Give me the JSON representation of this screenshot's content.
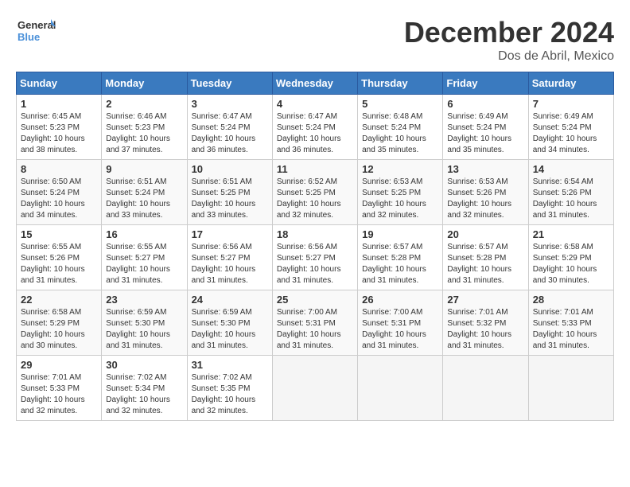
{
  "logo": {
    "text_general": "General",
    "text_blue": "Blue"
  },
  "header": {
    "month": "December 2024",
    "location": "Dos de Abril, Mexico"
  },
  "weekdays": [
    "Sunday",
    "Monday",
    "Tuesday",
    "Wednesday",
    "Thursday",
    "Friday",
    "Saturday"
  ],
  "weeks": [
    [
      {
        "day": "1",
        "info": "Sunrise: 6:45 AM\nSunset: 5:23 PM\nDaylight: 10 hours\nand 38 minutes."
      },
      {
        "day": "2",
        "info": "Sunrise: 6:46 AM\nSunset: 5:23 PM\nDaylight: 10 hours\nand 37 minutes."
      },
      {
        "day": "3",
        "info": "Sunrise: 6:47 AM\nSunset: 5:24 PM\nDaylight: 10 hours\nand 36 minutes."
      },
      {
        "day": "4",
        "info": "Sunrise: 6:47 AM\nSunset: 5:24 PM\nDaylight: 10 hours\nand 36 minutes."
      },
      {
        "day": "5",
        "info": "Sunrise: 6:48 AM\nSunset: 5:24 PM\nDaylight: 10 hours\nand 35 minutes."
      },
      {
        "day": "6",
        "info": "Sunrise: 6:49 AM\nSunset: 5:24 PM\nDaylight: 10 hours\nand 35 minutes."
      },
      {
        "day": "7",
        "info": "Sunrise: 6:49 AM\nSunset: 5:24 PM\nDaylight: 10 hours\nand 34 minutes."
      }
    ],
    [
      {
        "day": "8",
        "info": "Sunrise: 6:50 AM\nSunset: 5:24 PM\nDaylight: 10 hours\nand 34 minutes."
      },
      {
        "day": "9",
        "info": "Sunrise: 6:51 AM\nSunset: 5:24 PM\nDaylight: 10 hours\nand 33 minutes."
      },
      {
        "day": "10",
        "info": "Sunrise: 6:51 AM\nSunset: 5:25 PM\nDaylight: 10 hours\nand 33 minutes."
      },
      {
        "day": "11",
        "info": "Sunrise: 6:52 AM\nSunset: 5:25 PM\nDaylight: 10 hours\nand 32 minutes."
      },
      {
        "day": "12",
        "info": "Sunrise: 6:53 AM\nSunset: 5:25 PM\nDaylight: 10 hours\nand 32 minutes."
      },
      {
        "day": "13",
        "info": "Sunrise: 6:53 AM\nSunset: 5:26 PM\nDaylight: 10 hours\nand 32 minutes."
      },
      {
        "day": "14",
        "info": "Sunrise: 6:54 AM\nSunset: 5:26 PM\nDaylight: 10 hours\nand 31 minutes."
      }
    ],
    [
      {
        "day": "15",
        "info": "Sunrise: 6:55 AM\nSunset: 5:26 PM\nDaylight: 10 hours\nand 31 minutes."
      },
      {
        "day": "16",
        "info": "Sunrise: 6:55 AM\nSunset: 5:27 PM\nDaylight: 10 hours\nand 31 minutes."
      },
      {
        "day": "17",
        "info": "Sunrise: 6:56 AM\nSunset: 5:27 PM\nDaylight: 10 hours\nand 31 minutes."
      },
      {
        "day": "18",
        "info": "Sunrise: 6:56 AM\nSunset: 5:27 PM\nDaylight: 10 hours\nand 31 minutes."
      },
      {
        "day": "19",
        "info": "Sunrise: 6:57 AM\nSunset: 5:28 PM\nDaylight: 10 hours\nand 31 minutes."
      },
      {
        "day": "20",
        "info": "Sunrise: 6:57 AM\nSunset: 5:28 PM\nDaylight: 10 hours\nand 31 minutes."
      },
      {
        "day": "21",
        "info": "Sunrise: 6:58 AM\nSunset: 5:29 PM\nDaylight: 10 hours\nand 30 minutes."
      }
    ],
    [
      {
        "day": "22",
        "info": "Sunrise: 6:58 AM\nSunset: 5:29 PM\nDaylight: 10 hours\nand 30 minutes."
      },
      {
        "day": "23",
        "info": "Sunrise: 6:59 AM\nSunset: 5:30 PM\nDaylight: 10 hours\nand 31 minutes."
      },
      {
        "day": "24",
        "info": "Sunrise: 6:59 AM\nSunset: 5:30 PM\nDaylight: 10 hours\nand 31 minutes."
      },
      {
        "day": "25",
        "info": "Sunrise: 7:00 AM\nSunset: 5:31 PM\nDaylight: 10 hours\nand 31 minutes."
      },
      {
        "day": "26",
        "info": "Sunrise: 7:00 AM\nSunset: 5:31 PM\nDaylight: 10 hours\nand 31 minutes."
      },
      {
        "day": "27",
        "info": "Sunrise: 7:01 AM\nSunset: 5:32 PM\nDaylight: 10 hours\nand 31 minutes."
      },
      {
        "day": "28",
        "info": "Sunrise: 7:01 AM\nSunset: 5:33 PM\nDaylight: 10 hours\nand 31 minutes."
      }
    ],
    [
      {
        "day": "29",
        "info": "Sunrise: 7:01 AM\nSunset: 5:33 PM\nDaylight: 10 hours\nand 32 minutes."
      },
      {
        "day": "30",
        "info": "Sunrise: 7:02 AM\nSunset: 5:34 PM\nDaylight: 10 hours\nand 32 minutes."
      },
      {
        "day": "31",
        "info": "Sunrise: 7:02 AM\nSunset: 5:35 PM\nDaylight: 10 hours\nand 32 minutes."
      },
      {
        "day": "",
        "info": ""
      },
      {
        "day": "",
        "info": ""
      },
      {
        "day": "",
        "info": ""
      },
      {
        "day": "",
        "info": ""
      }
    ]
  ]
}
